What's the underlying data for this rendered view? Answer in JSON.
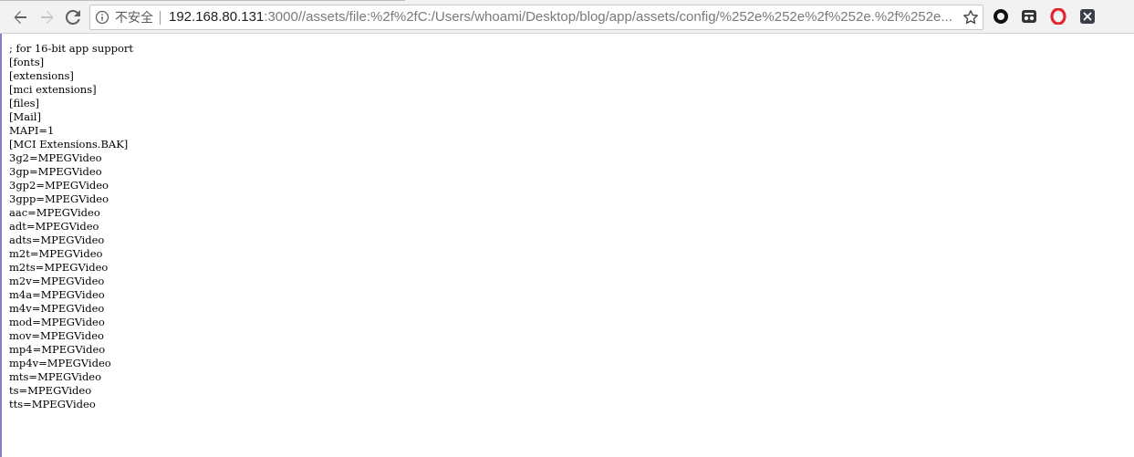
{
  "browser": {
    "nav": {
      "back_icon": "arrow-left-icon",
      "forward_icon": "arrow-right-icon",
      "reload_icon": "reload-icon"
    },
    "omnibox": {
      "info_icon": "info-circle-icon",
      "security_label": "不安全",
      "url_host": "192.168.80.131",
      "url_rest": ":3000//assets/file:%2f%2fC:/Users/whoami/Desktop/blog/app/assets/config/%252e%252e%2f%252e.%2f%252e....",
      "bookmark_icon": "star-outline-icon"
    },
    "extensions": [
      {
        "icon": "circle-ring-icon"
      },
      {
        "icon": "incognito-glasses-icon"
      },
      {
        "icon": "opera-o-icon"
      },
      {
        "icon": "x-square-icon"
      }
    ],
    "colors": {
      "opera_red": "#e0262e",
      "toolbar_bg": "#f2f2f2"
    }
  },
  "page": {
    "lines": [
      "; for 16-bit app support",
      "[fonts]",
      "[extensions]",
      "[mci extensions]",
      "[files]",
      "[Mail]",
      "MAPI=1",
      "[MCI Extensions.BAK]",
      "3g2=MPEGVideo",
      "3gp=MPEGVideo",
      "3gp2=MPEGVideo",
      "3gpp=MPEGVideo",
      "aac=MPEGVideo",
      "adt=MPEGVideo",
      "adts=MPEGVideo",
      "m2t=MPEGVideo",
      "m2ts=MPEGVideo",
      "m2v=MPEGVideo",
      "m4a=MPEGVideo",
      "m4v=MPEGVideo",
      "mod=MPEGVideo",
      "mov=MPEGVideo",
      "mp4=MPEGVideo",
      "mp4v=MPEGVideo",
      "mts=MPEGVideo",
      "ts=MPEGVideo",
      "tts=MPEGVideo"
    ]
  }
}
